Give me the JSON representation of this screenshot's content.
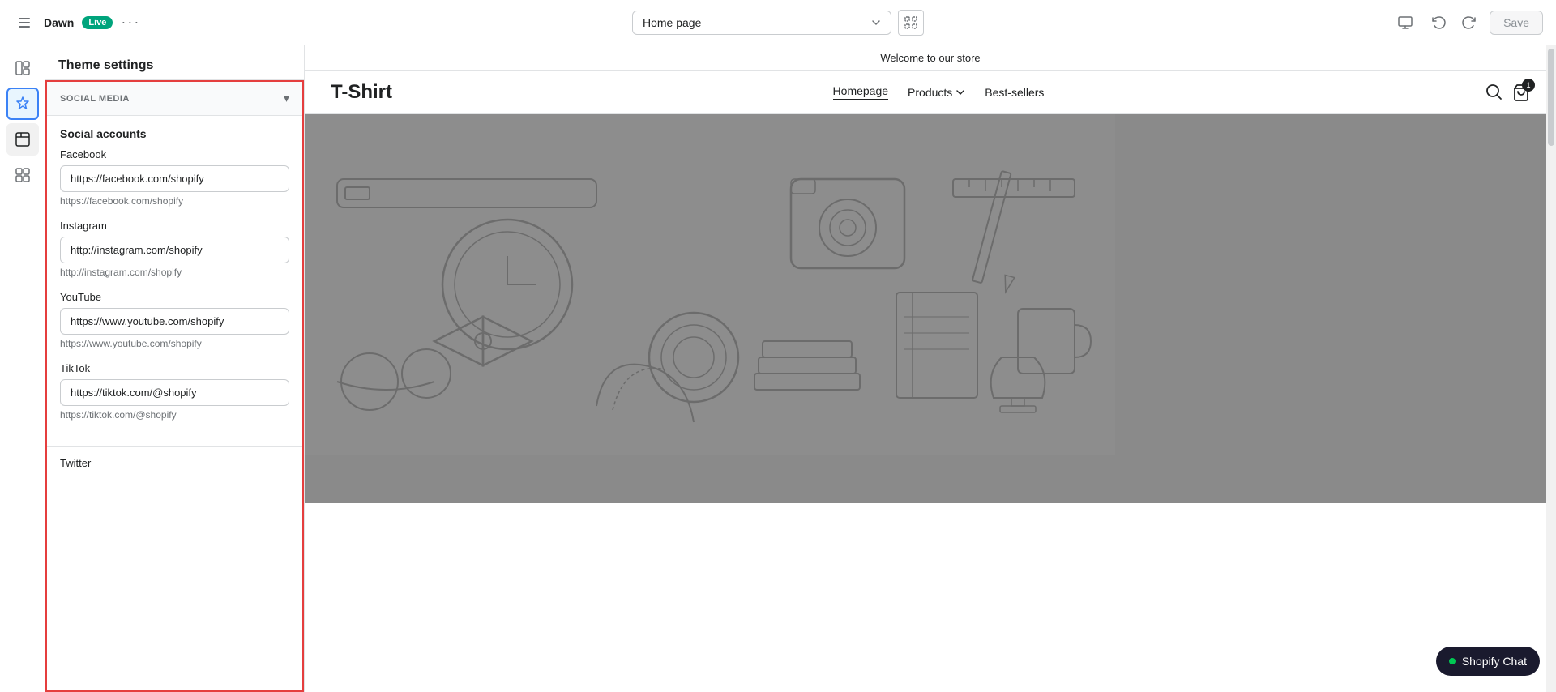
{
  "topbar": {
    "theme_name": "Dawn",
    "live_label": "Live",
    "page_selector": "Home page",
    "save_label": "Save"
  },
  "icon_sidebar": {
    "items": [
      {
        "name": "layout-icon",
        "label": "Layout",
        "active": false
      },
      {
        "name": "customizer-icon",
        "label": "Customizer",
        "active": false
      },
      {
        "name": "theme-settings-icon",
        "label": "Theme Settings",
        "active": true
      },
      {
        "name": "app-blocks-icon",
        "label": "App Blocks",
        "active": false
      }
    ]
  },
  "settings_panel": {
    "title": "Theme settings",
    "section": {
      "label": "SOCIAL MEDIA",
      "subsection_title": "Social accounts",
      "fields": [
        {
          "label": "Facebook",
          "value": "https://facebook.com/shopify",
          "hint": "https://facebook.com/shopify",
          "placeholder": "https://facebook.com/shopify"
        },
        {
          "label": "Instagram",
          "value": "http://instagram.com/shopify",
          "hint": "http://instagram.com/shopify",
          "placeholder": "http://instagram.com/shopify"
        },
        {
          "label": "YouTube",
          "value": "https://www.youtube.com/shopify",
          "hint": "https://www.youtube.com/shopify",
          "placeholder": "https://www.youtube.com/shopify"
        },
        {
          "label": "TikTok",
          "value": "https://tiktok.com/@shopify",
          "hint": "https://tiktok.com/@shopify",
          "placeholder": "https://tiktok.com/@shopify"
        }
      ],
      "twitter_label": "Twitter"
    }
  },
  "preview": {
    "announcement": "Welcome to our store",
    "logo": "T-Shirt",
    "nav_links": [
      "Homepage",
      "Products",
      "Best-sellers"
    ],
    "products_has_arrow": true,
    "cart_count": "1"
  },
  "chat_widget": {
    "label": "Shopify Chat"
  }
}
